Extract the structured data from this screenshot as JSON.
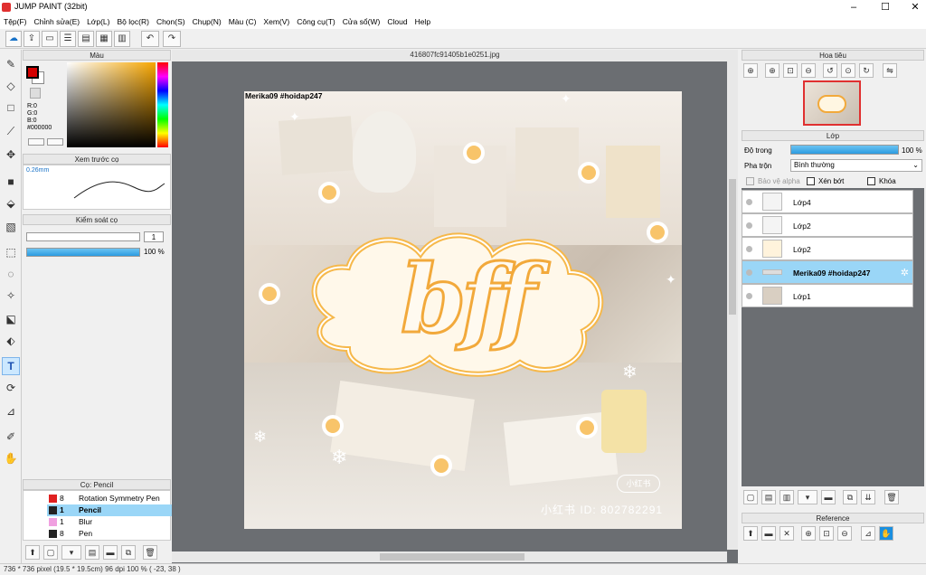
{
  "app": {
    "title": "JUMP PAINT (32bit)"
  },
  "menu": [
    "Tệp(F)",
    "Chỉnh sửa(E)",
    "Lớp(L)",
    "Bộ lọc(R)",
    "Chọn(S)",
    "Chụp(N)",
    "Màu (C)",
    "Xem(V)",
    "Công cụ(T)",
    "Cửa sổ(W)",
    "Cloud",
    "Help"
  ],
  "panels": {
    "color": "Màu",
    "preview": "Xem trước cọ",
    "brush_control": "Kiểm soát cọ",
    "brush_list": "Cọ: Pencil",
    "navigator": "Hoa tiêu",
    "layer": "Lớp",
    "reference": "Reference"
  },
  "color": {
    "r": "R:0",
    "g": "G:0",
    "b": "B:0",
    "hex": "#000000",
    "fg": "#d40000",
    "bg": "#ffffff"
  },
  "preview": {
    "size": "0.26mm"
  },
  "brush_control": {
    "size_value": "1",
    "opacity": "100 %",
    "opacity_level": 1.0
  },
  "brushes": [
    {
      "color": "#e02020",
      "size": "8",
      "name": "Rotation Symmetry Pen"
    },
    {
      "color": "#222222",
      "size": "1",
      "name": "Pencil"
    },
    {
      "color": "#f0a0e0",
      "size": "1",
      "name": "Blur"
    },
    {
      "color": "#222222",
      "size": "8",
      "name": "Pen"
    }
  ],
  "document": {
    "filename": "416807fc91405b1e0251.jpg"
  },
  "canvas": {
    "caption": "Merika09 #hoidap247",
    "center_text": "bff",
    "watermark_badge": "小红书",
    "watermark_id": "小红书 ID: 802782291"
  },
  "layer_panel": {
    "opacity_label": "Độ trong",
    "opacity_value": "100 %",
    "opacity_level": 1.0,
    "blend_label": "Pha trộn",
    "blend_value": "Bình thường",
    "protect_alpha": "Bảo vệ alpha",
    "clip": "Xén bớt",
    "lock": "Khóa"
  },
  "layers": [
    {
      "name": "Lớp4"
    },
    {
      "name": "Lớp2"
    },
    {
      "name": "Lớp2"
    },
    {
      "name": "Merika09 #hoidap247"
    },
    {
      "name": "Lớp1"
    }
  ],
  "status": {
    "text": "736 * 736 pixel  (19.5 * 19.5cm)  96 dpi  100 %  ( -23, 38 )"
  }
}
